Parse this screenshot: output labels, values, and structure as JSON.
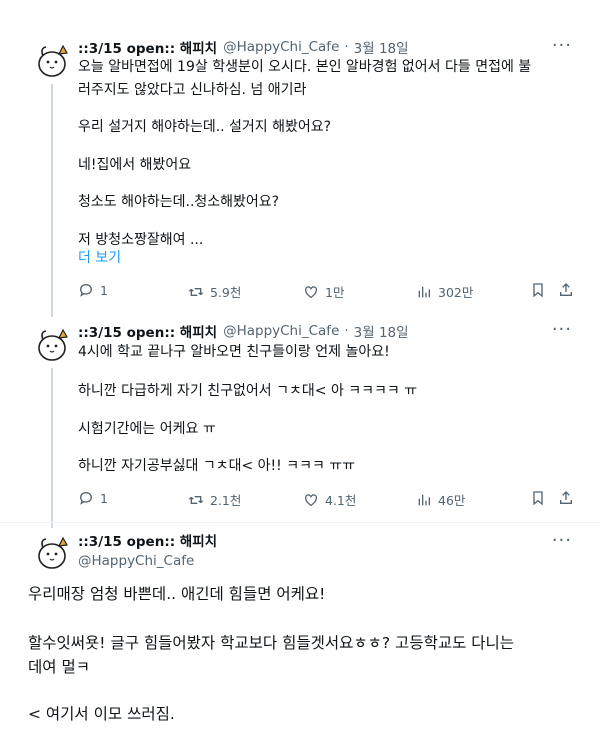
{
  "tweets": [
    {
      "name": "::3/15 open:: 해피치",
      "handle": "@HappyChi_Cafe",
      "dot": "·",
      "date": "3월 18일",
      "more": "···",
      "lines": [
        "오늘 알바면접에 19살 학생분이 오시다. 본인 알바경험 없어서 다들 면접에 불",
        "러주지도 않았다고 신나하심. 넘 애기라",
        "우리 설거지 해야하는데.. 설거지 해봤어요?",
        "네!집에서 해봤어요",
        "청소도 해야하는데..청소해봤어요?",
        "저 방청소짱잘해여 ..."
      ],
      "show_more": "더 보기",
      "replies": "1",
      "retweets": "5.9천",
      "likes": "1만",
      "views": "302만"
    },
    {
      "name": "::3/15 open:: 해피치",
      "handle": "@HappyChi_Cafe",
      "dot": "·",
      "date": "3월 18일",
      "more": "···",
      "lines": [
        "4시에 학교 끝나구 알바오면 친구들이랑 언제 놀아요!",
        "하니깐 다급하게 자기 친구없어서 ㄱㅊ대< 아 ㅋㅋㅋㅋ ㅠ",
        "시험기간에는 어케요 ㅠ",
        "하니깐 자기공부싫대 ㄱㅊ대< 아!! ㅋㅋㅋ ㅠㅠ"
      ],
      "replies": "1",
      "retweets": "2.1천",
      "likes": "4.1천",
      "views": "46만"
    },
    {
      "name": "::3/15 open:: 해피치",
      "handle": "@HappyChi_Cafe",
      "more": "···",
      "lines": [
        "우리매장 엄청 바쁜데.. 애긴데 힘들면 어케요!",
        "할수잇써욧! 글구 힘들어봤자 학교보다 힘들겟서요ㅎㅎ? 고등학교도 다니는",
        "데여 멀ㅋ",
        "< 여기서 이모 쓰러짐."
      ]
    }
  ],
  "icons": [
    "reply-icon",
    "retweet-icon",
    "like-icon",
    "views-icon",
    "bookmark-icon",
    "share-icon",
    "more-icon"
  ]
}
